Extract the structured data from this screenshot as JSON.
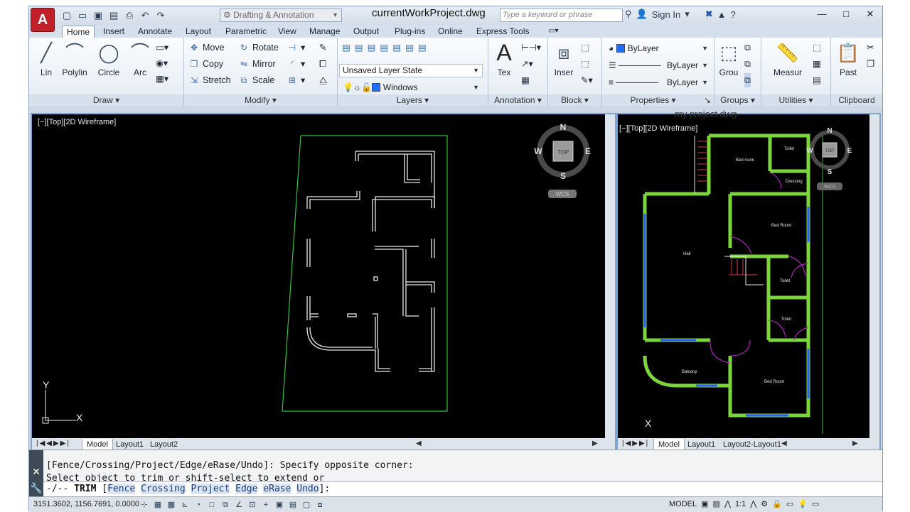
{
  "app": {
    "logo": "A",
    "document_title": "currentWorkProject.dwg"
  },
  "workspace": {
    "selected": "Drafting & Annotation"
  },
  "search": {
    "placeholder": "Type a keyword or phrase"
  },
  "account": {
    "sign_in": "Sign In"
  },
  "ribbon_tabs": [
    "Home",
    "Insert",
    "Annotate",
    "Layout",
    "Parametric",
    "View",
    "Manage",
    "Output",
    "Plug-ins",
    "Online",
    "Express Tools"
  ],
  "ribbon": {
    "draw": {
      "title": "Draw",
      "line": "Lin",
      "polyline": "Polylin",
      "circle": "Circle",
      "arc": "Arc"
    },
    "modify": {
      "title": "Modify",
      "move": "Move",
      "rotate": "Rotate",
      "copy": "Copy",
      "mirror": "Mirror",
      "stretch": "Stretch",
      "scale": "Scale"
    },
    "layers": {
      "title": "Layers",
      "layer_state": "Unsaved Layer State",
      "current_layer": "Windows"
    },
    "annotation": {
      "title": "Annotation",
      "text": "Tex"
    },
    "block": {
      "title": "Block",
      "insert": "Inser"
    },
    "properties": {
      "title": "Properties",
      "color": "ByLayer",
      "linetype": "ByLayer",
      "lineweight": "ByLayer"
    },
    "groups": {
      "title": "Groups",
      "group": "Grou"
    },
    "utilities": {
      "title": "Utilities",
      "measure": "Measur"
    },
    "clipboard": {
      "title": "Clipboard",
      "paste": "Past"
    }
  },
  "viewport_left": {
    "label": "[−][Top][2D Wireframe]",
    "tabs": [
      "Model",
      "Layout1",
      "Layout2"
    ]
  },
  "viewport_right": {
    "title": "my project.dwg",
    "label": "[−][Top][2D Wireframe]",
    "tabs": [
      "Model",
      "Layout1",
      "Layout2-Layout1"
    ],
    "rooms": [
      "Bed room",
      "Toilet",
      "Dressing",
      "Bed Room",
      "Hall",
      "Toilet",
      "Toilet",
      "Balcony",
      "Bed Room"
    ]
  },
  "viewcube": {
    "n": "N",
    "s": "S",
    "e": "E",
    "w": "W",
    "top": "TOP",
    "wcs": "WCS"
  },
  "ucs": {
    "x": "X",
    "y": "Y"
  },
  "command": {
    "line1": "[Fence/Crossing/Project/Edge/eRase/Undo]: Specify opposite corner:",
    "line2": "Select object to trim or shift-select to extend or",
    "prompt_cmd": "TRIM",
    "options": [
      "Fence",
      "Crossing",
      "Project",
      "Edge",
      "eRase",
      "Undo"
    ]
  },
  "status": {
    "coordinates": "3151.3602, 1156.7691, 0.0000",
    "space": "MODEL",
    "scale": "1:1"
  },
  "colors": {
    "bylayer_swatch": "#1f6fff",
    "windows_swatch": "#1f6fff",
    "wall_hatch": "#7bd63b",
    "window_blue": "#2a5bff",
    "door_magenta": "#b020c0",
    "stair_red": "#d43a3a",
    "boundary_green": "#2fc43a"
  }
}
